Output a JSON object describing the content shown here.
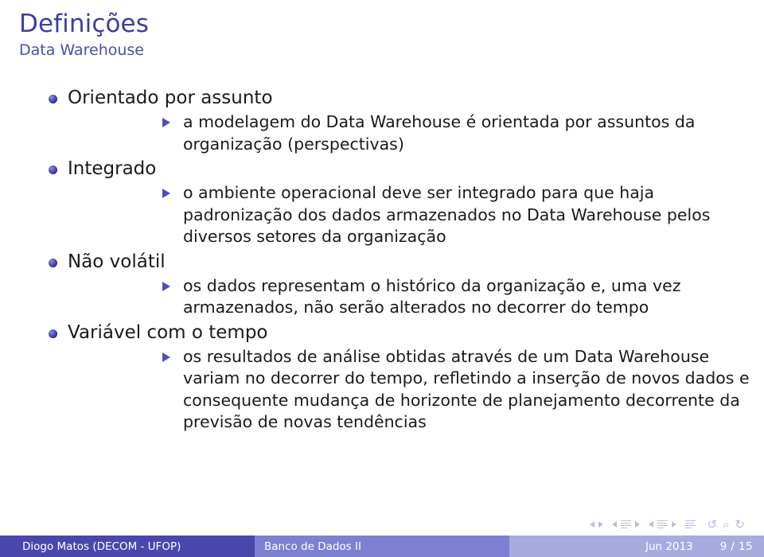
{
  "slide": {
    "title": "Definições",
    "subtitle": "Data Warehouse",
    "title_color": "#3b3f9e",
    "subtitle_color": "#4a4fad"
  },
  "content": {
    "items": [
      {
        "label": "Orientado por assunto",
        "subitems": [
          "a modelagem do Data Warehouse é orientada por assuntos da organização (perspectivas)"
        ]
      },
      {
        "label": "Integrado",
        "subitems": [
          "o ambiente operacional deve ser integrado para que haja padronização dos dados armazenados no Data Warehouse pelos diversos setores da organização"
        ]
      },
      {
        "label": "Não volátil",
        "subitems": [
          "os dados representam o histórico da organização e, uma vez armazenados, não serão alterados no decorrer do tempo"
        ]
      },
      {
        "label": "Variável com o tempo",
        "subitems": [
          "os resultados de análise obtidas através de um Data Warehouse variam no decorrer do tempo, refletindo a inserção de novos dados e consequente mudança de horizonte de planejamento decorrente da previsão de novas tendências"
        ]
      }
    ]
  },
  "navigation_symbols": {
    "icons": [
      "prev-slide-icon",
      "next-slide-icon",
      "prev-frame-icon",
      "frame-icon",
      "next-frame-icon",
      "prev-subsection-icon",
      "subsection-icon",
      "next-subsection-icon",
      "section-icon",
      "back-icon",
      "search-icon",
      "forward-icon"
    ]
  },
  "footer": {
    "author": "Diogo Matos (DECOM - UFOP)",
    "title": "Banco de Dados II",
    "date": "Jun 2013",
    "page": "9 / 15",
    "author_bg": "#4a47ac",
    "title_bg": "#7d7fd0",
    "date_bg": "#a8abe0"
  }
}
